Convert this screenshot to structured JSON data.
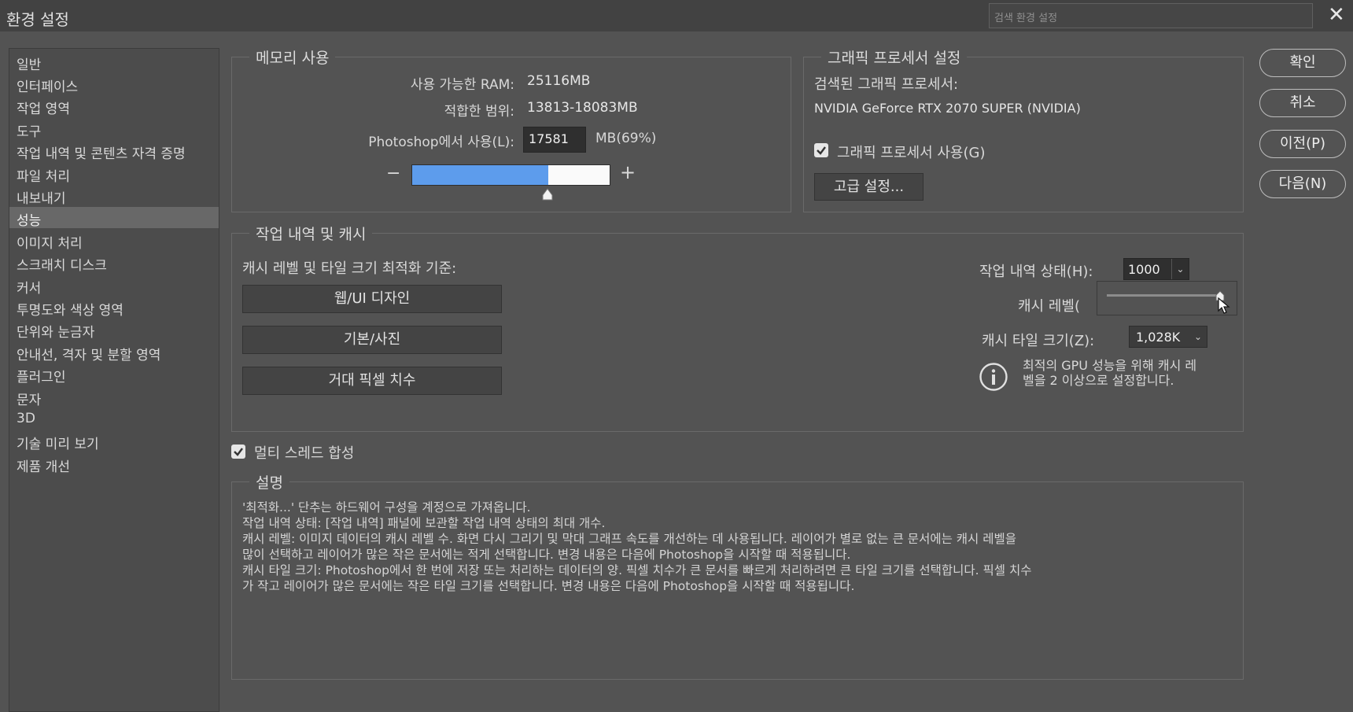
{
  "window": {
    "title": "환경 설정",
    "search_placeholder": "검색 환경 설정",
    "close_glyph": "✕"
  },
  "sidebar": {
    "items": [
      {
        "label": "일반"
      },
      {
        "label": "인터페이스"
      },
      {
        "label": "작업 영역"
      },
      {
        "label": "도구"
      },
      {
        "label": "작업 내역 및 콘텐츠 자격 증명"
      },
      {
        "label": "파일 처리"
      },
      {
        "label": "내보내기"
      },
      {
        "label": "성능",
        "selected": true
      },
      {
        "label": "이미지 처리"
      },
      {
        "label": "스크래치 디스크"
      },
      {
        "label": "커서"
      },
      {
        "label": "투명도와 색상 영역"
      },
      {
        "label": "단위와 눈금자"
      },
      {
        "label": "안내선, 격자 및 분할 영역"
      },
      {
        "label": "플러그인"
      },
      {
        "label": "문자"
      },
      {
        "label": "3D"
      },
      {
        "label": "기술 미리 보기"
      },
      {
        "label": "제품 개선"
      }
    ]
  },
  "memory": {
    "legend": "메모리 사용",
    "available_label": "사용 가능한 RAM:",
    "available_value": "25116MB",
    "ideal_label": "적합한 범위:",
    "ideal_value": "13813-18083MB",
    "use_label": "Photoshop에서 사용(L):",
    "use_value": "17581",
    "use_unit": "MB(69%)",
    "minus": "−",
    "plus": "+",
    "slider_fraction": 0.69
  },
  "gpu": {
    "legend": "그래픽 프로세서 설정",
    "detected_label": "검색된 그래픽 프로세서:",
    "detected_value": "NVIDIA GeForce RTX 2070 SUPER (NVIDIA)",
    "use_gpu_label": "그래픽 프로세서 사용(G)",
    "use_gpu_checked": true,
    "advanced_button": "고급 설정..."
  },
  "buttons": {
    "ok": "확인",
    "cancel": "취소",
    "prev": "이전(P)",
    "next": "다음(N)"
  },
  "history": {
    "legend": "작업 내역 및 캐시",
    "optimize_label": "캐시 레벨 및 타일 크기 최적화 기준:",
    "preset_buttons": [
      "웹/UI 디자인",
      "기본/사진",
      "거대 픽셀 치수"
    ],
    "states_label": "작업 내역 상태(H):",
    "states_value": "1000",
    "cache_levels_label": "캐시 레벨(",
    "cache_tile_label": "캐시 타일 크기(Z):",
    "cache_tile_value": "1,028K",
    "info_text_1": "최적의 GPU 성능을 위해 캐시 레",
    "info_text_2": "벨을 2 이상으로 설정합니다."
  },
  "multithread": {
    "label": "멀티 스레드 합성",
    "checked": true
  },
  "description": {
    "legend": "설명",
    "lines": [
      "'최적화...' 단추는 하드웨어 구성을 계정으로 가져옵니다.",
      "작업 내역 상태: [작업 내역] 패널에 보관할 작업 내역 상태의 최대 개수.",
      "캐시 레벨: 이미지 데이터의 캐시 레벨 수. 화면 다시 그리기 및 막대 그래프 속도를 개선하는 데 사용됩니다. 레이어가 별로 없는 큰 문서에는 캐시 레벨을",
      "많이 선택하고 레이어가 많은 작은 문서에는 적게 선택합니다. 변경 내용은 다음에 Photoshop을 시작할 때 적용됩니다.",
      "캐시 타일 크기: Photoshop에서 한 번에 저장 또는 처리하는 데이터의 양. 픽셀 치수가 큰 문서를 빠르게 처리하려면 큰 타일 크기를 선택합니다. 픽셀 치수",
      "가 작고 레이어가 많은 문서에는 작은 타일 크기를 선택합니다. 변경 내용은 다음에 Photoshop을 시작할 때 적용됩니다."
    ]
  }
}
